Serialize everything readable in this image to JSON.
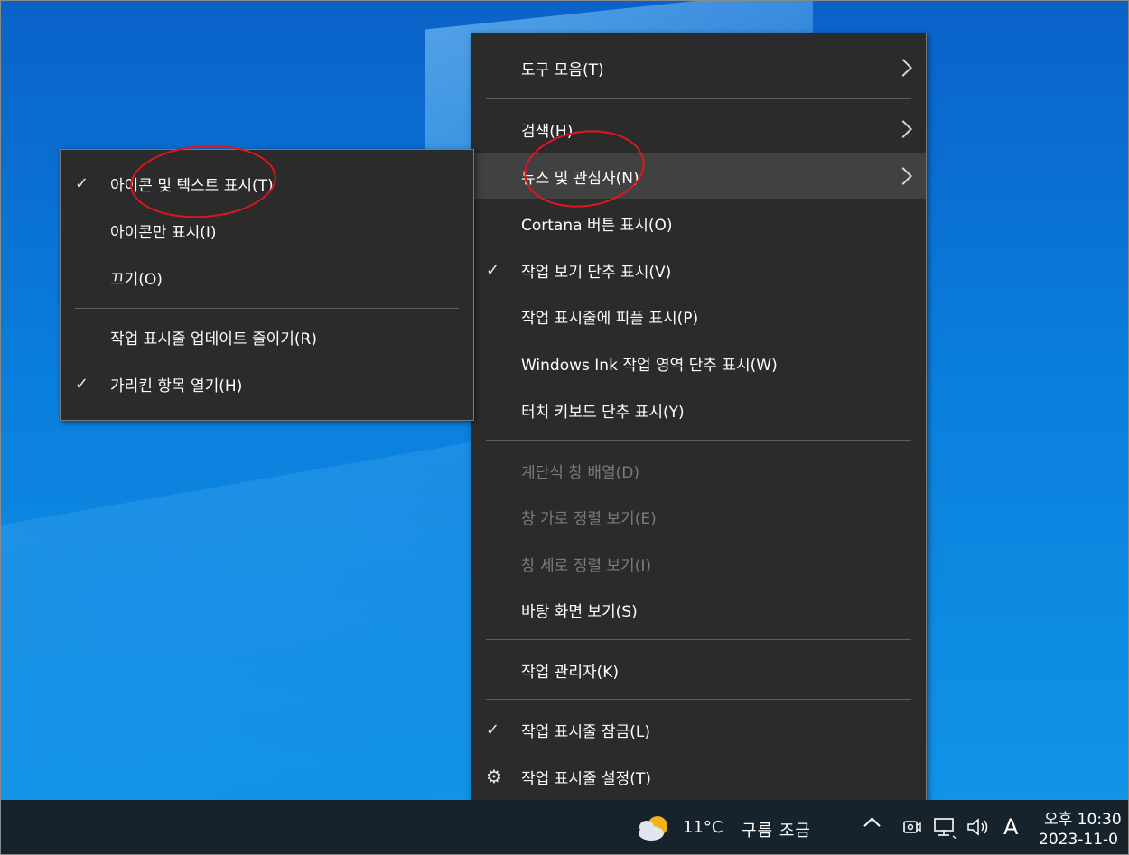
{
  "context_menu": {
    "items": [
      {
        "label": "도구 모음(T)",
        "submenu": true
      },
      {
        "label": "검색(H)",
        "submenu": true
      },
      {
        "label": "뉴스 및 관심사(N)",
        "submenu": true,
        "highlighted": true
      },
      {
        "label": "Cortana 버튼 표시(O)"
      },
      {
        "label": "작업 보기 단추 표시(V)",
        "checked": true
      },
      {
        "label": "작업 표시줄에 피플 표시(P)"
      },
      {
        "label": "Windows Ink 작업 영역 단추 표시(W)"
      },
      {
        "label": "터치 키보드 단추 표시(Y)"
      },
      {
        "label": "계단식 창 배열(D)",
        "disabled": true
      },
      {
        "label": "창 가로 정렬 보기(E)",
        "disabled": true
      },
      {
        "label": "창 세로 정렬 보기(I)",
        "disabled": true
      },
      {
        "label": "바탕 화면 보기(S)"
      },
      {
        "label": "작업 관리자(K)"
      },
      {
        "label": "작업 표시줄 잠금(L)",
        "checked": true
      },
      {
        "label": "작업 표시줄 설정(T)",
        "icon": "gear-icon"
      }
    ]
  },
  "submenu": {
    "items": [
      {
        "label": "아이콘 및 텍스트 표시(T)",
        "checked": true
      },
      {
        "label": "아이콘만 표시(I)"
      },
      {
        "label": "끄기(O)"
      },
      {
        "label": "작업 표시줄 업데이트 줄이기(R)"
      },
      {
        "label": "가리킨 항목 열기(H)",
        "checked": true
      }
    ]
  },
  "taskbar": {
    "weather_temp": "11°C",
    "weather_desc": "구름 조금",
    "ime": "A",
    "time": "오후 10:30",
    "date": "2023-11-0",
    "icons": [
      "weather-icon",
      "chevron-up-icon",
      "meet-now-icon",
      "network-icon",
      "volume-icon"
    ]
  },
  "colors": {
    "menu_bg": "#2b2b2b",
    "highlight": "#414141",
    "disabled": "#7b7b7b",
    "annotation": "#e0161f"
  }
}
